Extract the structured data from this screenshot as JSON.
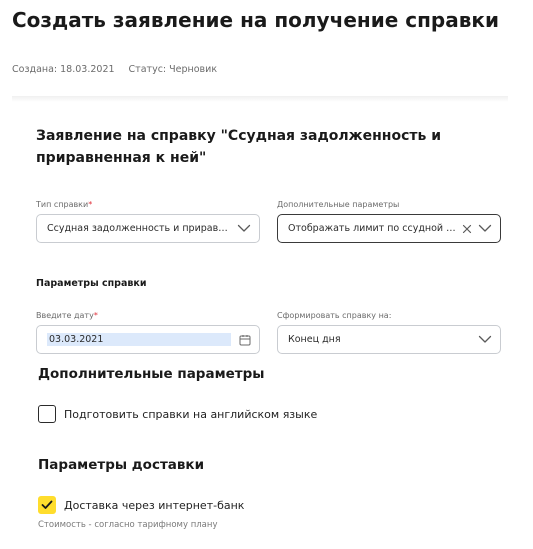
{
  "header": {
    "title": "Создать заявление на получение справки",
    "created": "Создана: 18.03.2021",
    "status": "Статус: Черновик"
  },
  "form": {
    "title": "Заявление на справку \"Ссудная задолженность и приравненная к ней\"",
    "type_label": "Тип справки",
    "type_required_mark": "*",
    "type_value": "Ссудная задолженность и приравненная к ней",
    "extra_label": "Дополнительные параметры",
    "extra_value": "Отображать лимит по ссудной задолженности",
    "params_heading": "Параметры справки",
    "date_label": "Введите дату",
    "date_required_mark": "*",
    "date_value": "03.03.2021",
    "form_on_label": "Сформировать справку на:",
    "form_on_value": "Конец дня"
  },
  "additional": {
    "heading": "Дополнительные параметры",
    "english_label": "Подготовить справки на английском языке",
    "english_checked": false
  },
  "delivery": {
    "heading": "Параметры доставки",
    "internet_bank_label": "Доставка через интернет-банк",
    "internet_bank_checked": true,
    "cost_note": "Стоимость - согласно тарифному плану"
  },
  "colors": {
    "accent_yellow": "#ffdd2d",
    "date_highlight": "#dce9fb",
    "required_red": "#e0303a"
  },
  "icons": {
    "dropdown": "chevron-down-icon",
    "clear": "close-icon",
    "calendar": "calendar-icon",
    "check": "check-icon"
  }
}
